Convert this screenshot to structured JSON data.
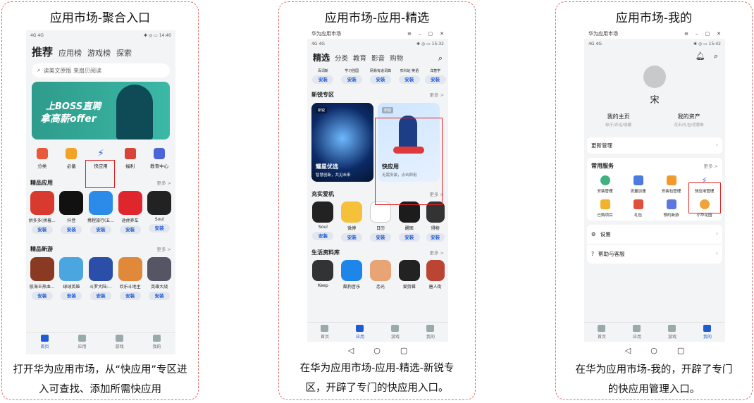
{
  "panel1": {
    "title": "应用市场-聚合入口",
    "caption": "打开华为应用市场，从“快应用”专区进入可查找、添加所需快应用",
    "status": {
      "left": "4G 4G",
      "right": "✱ ◎ ▭ 14:40"
    },
    "tabs": [
      "推荐",
      "应用榜",
      "游戏榜",
      "探索"
    ],
    "search_placeholder": "读美文原版 来扇贝阅读",
    "banner": {
      "line1": "上BOSS直聘",
      "line2": "拿高薪offer"
    },
    "shortcuts": [
      "分类",
      "必备",
      "快应用",
      "福利",
      "教育中心"
    ],
    "section1": {
      "title": "精品应用",
      "more": "更多 >",
      "apps": [
        "拼多多(拼着...",
        "抖音",
        "携程旅行(五...",
        "途虎养车",
        "Soul"
      ]
    },
    "section2": {
      "title": "精品新游",
      "more": "更多 >",
      "apps": [
        "航海王热血...",
        "球球英雄",
        "斗罗大陆:...",
        "欢乐斗地主",
        "英雄大战"
      ]
    },
    "install": "安装",
    "nav": [
      "首页",
      "应用",
      "游戏",
      "我的"
    ]
  },
  "panel2": {
    "title": "应用市场-应用-精选",
    "caption": "在华为应用市场-应用-精选-新锐专区，开辟了专门的快应用入口。",
    "window_title": "华为应用市场",
    "status": {
      "left": "4G 4G",
      "right": "✱ ◎ ▭ 15:32"
    },
    "tabs": [
      "精选",
      "分类",
      "教育",
      "影音",
      "购物"
    ],
    "top_apps": [
      "百词斩",
      "学习强国",
      "网易有道词典",
      "农科站·英语",
      "洋葱学"
    ],
    "new_section": {
      "title": "新锐专区",
      "more": "更多 >",
      "card1_title": "耀星优选",
      "card1_sub": "智慧创新，共见未来",
      "card1_tag": "新锐",
      "card2_title": "快应用",
      "card2_sub": "无需安装，点击即用",
      "card2_tag": "新锐"
    },
    "section2": {
      "title": "充实爱机",
      "more": "更多 >",
      "apps": [
        "Soul",
        "微博",
        "日历",
        "醒图",
        "得物"
      ]
    },
    "section3": {
      "title": "生活资料库",
      "more": "更多 >",
      "apps": [
        "Keep",
        "酷狗音乐",
        "恋光",
        "爱剪辑",
        "唐人街"
      ]
    },
    "install": "安装",
    "nav": [
      "首页",
      "应用",
      "游戏",
      "我的"
    ],
    "sysnav": [
      "◁",
      "○",
      "▢"
    ]
  },
  "panel3": {
    "title": "应用市场-我的",
    "caption": "在华为应用市场-我的，开辟了专门的快应用管理入口。",
    "window_title": "华为应用市场",
    "status": {
      "left": "4G 4G",
      "right": "✱ ◎ ▭ 15:42"
    },
    "username": "宋",
    "home_label": "我的主页",
    "home_sub": "帖子/评论/收藏",
    "assets_label": "我的资产",
    "assets_sub": "花币/礼包/优惠券",
    "update": "更新管理",
    "services_title": "常用服务",
    "services_more": "更多 >",
    "services": [
      "安装管理",
      "流量加速",
      "安装包管理",
      "快应用管理",
      "已购项目",
      "礼包",
      "预约新游",
      "小华花园"
    ],
    "settings": "设置",
    "help": "帮助与客服",
    "nav": [
      "首页",
      "应用",
      "游戏",
      "我的"
    ],
    "sysnav": [
      "◁",
      "○",
      "▢"
    ]
  }
}
